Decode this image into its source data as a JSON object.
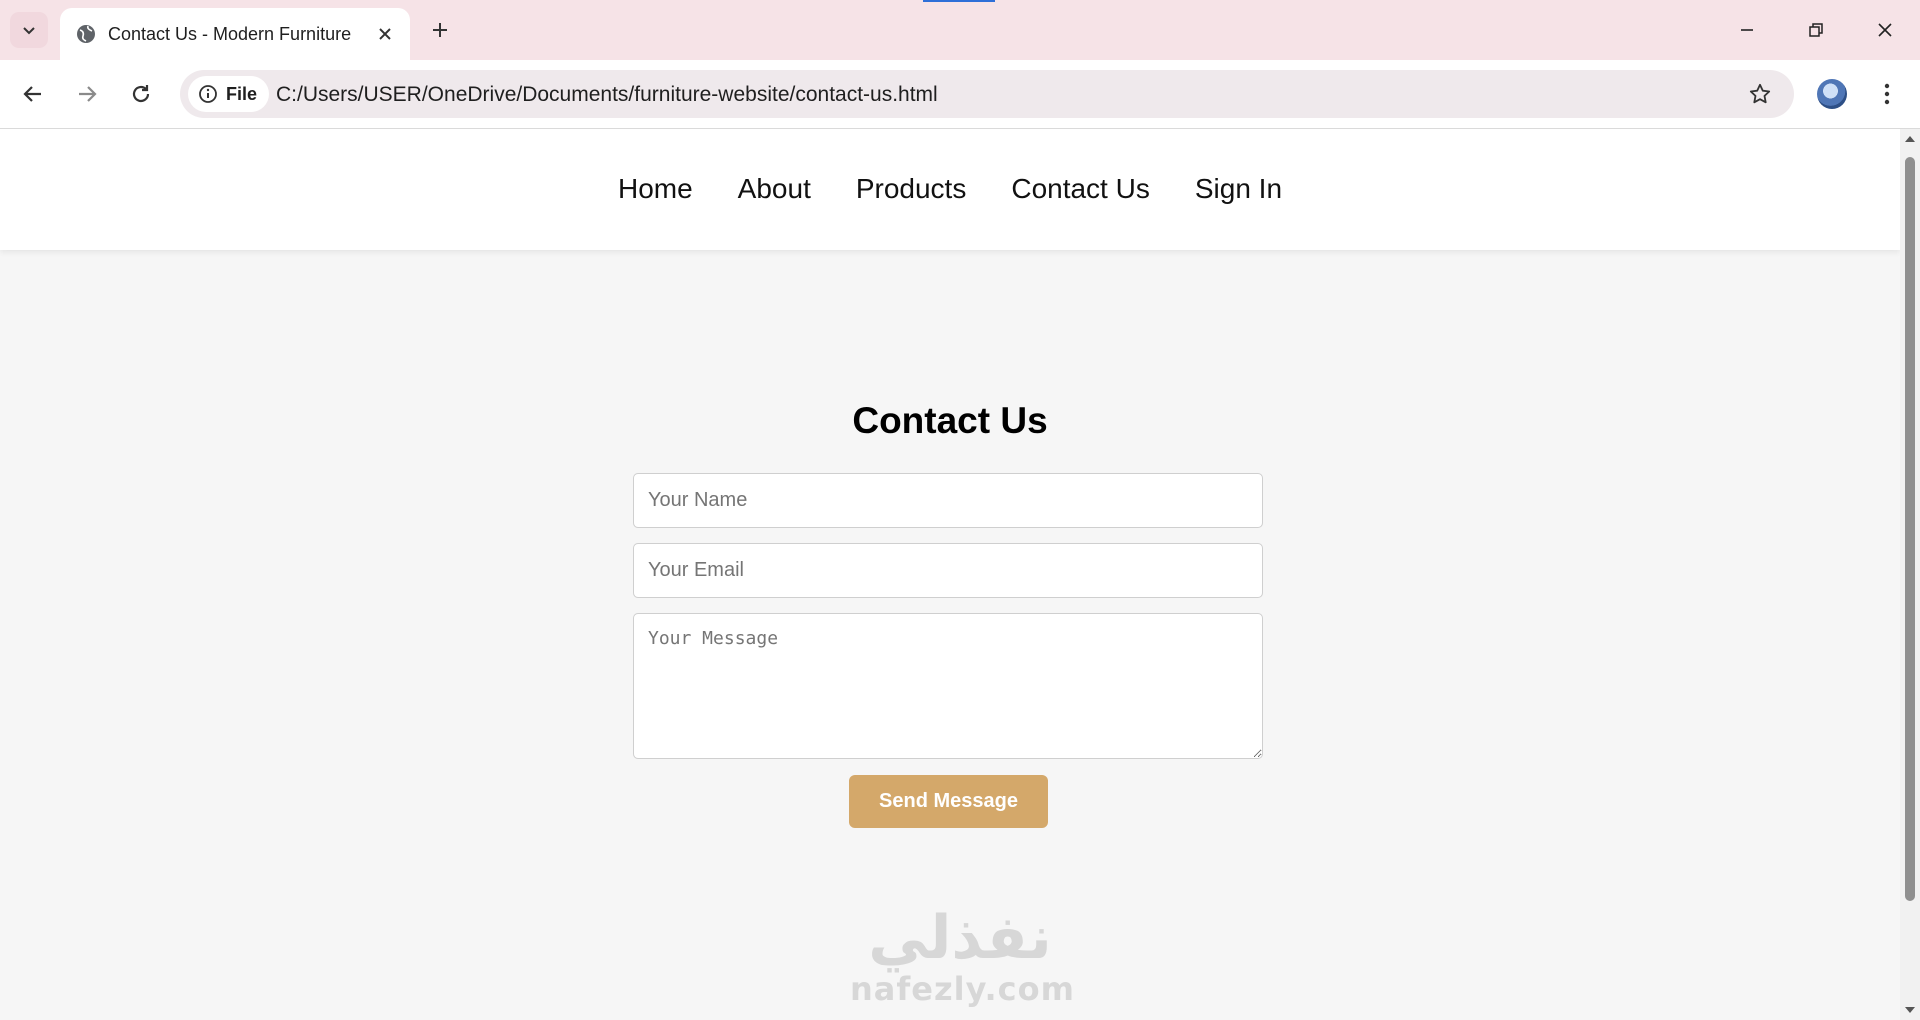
{
  "browser": {
    "tab_title": "Contact Us - Modern Furniture",
    "new_tab_symbol": "+",
    "address_chip_label": "File",
    "url": "C:/Users/USER/OneDrive/Documents/furniture-website/contact-us.html",
    "icons": [
      "tab-search-icon",
      "globe-icon",
      "close-icon",
      "plus-icon",
      "minimize-icon",
      "restore-icon",
      "window-close-icon",
      "back-icon",
      "forward-icon",
      "reload-icon",
      "info-icon",
      "star-icon",
      "profile-avatar",
      "more-vert-icon"
    ]
  },
  "site": {
    "nav": [
      "Home",
      "About",
      "Products",
      "Contact Us",
      "Sign In"
    ]
  },
  "contact": {
    "title": "Contact Us",
    "name_placeholder": "Your Name",
    "email_placeholder": "Your Email",
    "message_placeholder": "Your Message",
    "submit_label": "Send Message"
  },
  "watermark": {
    "arabic": "نفذلي",
    "latin": "nafezly.com"
  },
  "colors": {
    "accent_button": "#d4a86a",
    "tabstrip": "#f6e3e7",
    "page_background": "#f6f6f6"
  }
}
